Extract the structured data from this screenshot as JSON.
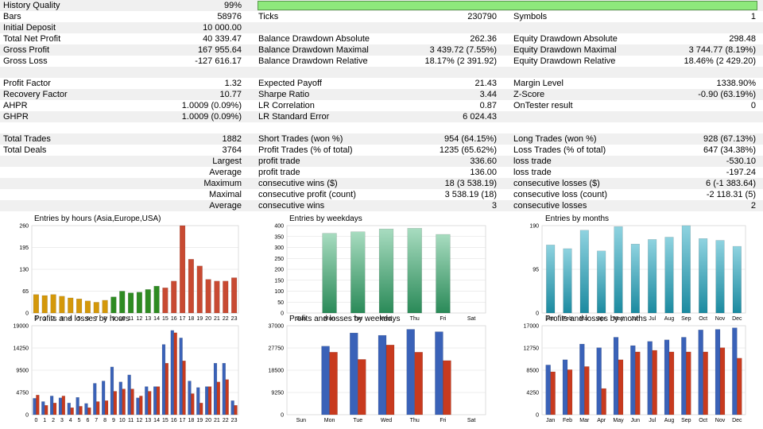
{
  "stats": {
    "rows": [
      {
        "alt": true,
        "cells": [
          {
            "t": "History Quality"
          },
          {
            "t": "99%"
          },
          {
            "t": ""
          },
          {
            "t": ""
          },
          {
            "t": ""
          },
          {
            "t": ""
          }
        ],
        "quality_bar": 0.99
      },
      {
        "alt": false,
        "cells": [
          {
            "t": "Bars"
          },
          {
            "t": "58976"
          },
          {
            "t": "Ticks"
          },
          {
            "t": "230790"
          },
          {
            "t": "Symbols"
          },
          {
            "t": "1"
          }
        ]
      },
      {
        "alt": true,
        "cells": [
          {
            "t": "Initial Deposit"
          },
          {
            "t": "10 000.00"
          },
          {
            "t": ""
          },
          {
            "t": ""
          },
          {
            "t": ""
          },
          {
            "t": ""
          }
        ]
      },
      {
        "alt": false,
        "cells": [
          {
            "t": "Total Net Profit"
          },
          {
            "t": "40 339.47"
          },
          {
            "t": "Balance Drawdown Absolute"
          },
          {
            "t": "262.36"
          },
          {
            "t": "Equity Drawdown Absolute"
          },
          {
            "t": "298.48"
          }
        ]
      },
      {
        "alt": true,
        "cells": [
          {
            "t": "Gross Profit"
          },
          {
            "t": "167 955.64"
          },
          {
            "t": "Balance Drawdown Maximal"
          },
          {
            "t": "3 439.72 (7.55%)"
          },
          {
            "t": "Equity Drawdown Maximal"
          },
          {
            "t": "3 744.77 (8.19%)"
          }
        ]
      },
      {
        "alt": false,
        "cells": [
          {
            "t": "Gross Loss"
          },
          {
            "t": "-127 616.17"
          },
          {
            "t": "Balance Drawdown Relative"
          },
          {
            "t": "18.17% (2 391.92)"
          },
          {
            "t": "Equity Drawdown Relative"
          },
          {
            "t": "18.46% (2 429.20)"
          }
        ]
      },
      {
        "alt": true,
        "cells": [
          {
            "t": ""
          },
          {
            "t": ""
          },
          {
            "t": ""
          },
          {
            "t": ""
          },
          {
            "t": ""
          },
          {
            "t": ""
          }
        ]
      },
      {
        "alt": false,
        "cells": [
          {
            "t": "Profit Factor"
          },
          {
            "t": "1.32"
          },
          {
            "t": "Expected Payoff"
          },
          {
            "t": "21.43"
          },
          {
            "t": "Margin Level"
          },
          {
            "t": "1338.90%"
          }
        ]
      },
      {
        "alt": true,
        "cells": [
          {
            "t": "Recovery Factor"
          },
          {
            "t": "10.77"
          },
          {
            "t": "Sharpe Ratio"
          },
          {
            "t": "3.44"
          },
          {
            "t": "Z-Score"
          },
          {
            "t": "-0.90 (63.19%)"
          }
        ]
      },
      {
        "alt": false,
        "cells": [
          {
            "t": "AHPR"
          },
          {
            "t": "1.0009 (0.09%)"
          },
          {
            "t": "LR Correlation"
          },
          {
            "t": "0.87"
          },
          {
            "t": "OnTester result"
          },
          {
            "t": "0"
          }
        ]
      },
      {
        "alt": true,
        "cells": [
          {
            "t": "GHPR"
          },
          {
            "t": "1.0009 (0.09%)"
          },
          {
            "t": "LR Standard Error"
          },
          {
            "t": "6 024.43"
          },
          {
            "t": ""
          },
          {
            "t": ""
          }
        ]
      },
      {
        "alt": false,
        "cells": [
          {
            "t": ""
          },
          {
            "t": ""
          },
          {
            "t": ""
          },
          {
            "t": ""
          },
          {
            "t": ""
          },
          {
            "t": ""
          }
        ]
      },
      {
        "alt": true,
        "cells": [
          {
            "t": "Total Trades"
          },
          {
            "t": "1882"
          },
          {
            "t": "Short Trades (won %)"
          },
          {
            "t": "954 (64.15%)"
          },
          {
            "t": "Long Trades (won %)"
          },
          {
            "t": "928 (67.13%)"
          }
        ]
      },
      {
        "alt": false,
        "cells": [
          {
            "t": "Total Deals"
          },
          {
            "t": "3764"
          },
          {
            "t": "Profit Trades (% of total)"
          },
          {
            "t": "1235 (65.62%)"
          },
          {
            "t": "Loss Trades (% of total)"
          },
          {
            "t": "647 (34.38%)"
          }
        ]
      },
      {
        "alt": true,
        "cells": [
          {
            "t": ""
          },
          {
            "t": "Largest"
          },
          {
            "t": "profit trade"
          },
          {
            "t": "336.60"
          },
          {
            "t": "loss trade"
          },
          {
            "t": "-530.10"
          }
        ]
      },
      {
        "alt": false,
        "cells": [
          {
            "t": ""
          },
          {
            "t": "Average"
          },
          {
            "t": "profit trade"
          },
          {
            "t": "136.00"
          },
          {
            "t": "loss trade"
          },
          {
            "t": "-197.24"
          }
        ]
      },
      {
        "alt": true,
        "cells": [
          {
            "t": ""
          },
          {
            "t": "Maximum"
          },
          {
            "t": "consecutive wins ($)"
          },
          {
            "t": "18 (3 538.19)"
          },
          {
            "t": "consecutive losses ($)"
          },
          {
            "t": "6 (-1 383.64)"
          }
        ]
      },
      {
        "alt": false,
        "cells": [
          {
            "t": ""
          },
          {
            "t": "Maximal"
          },
          {
            "t": "consecutive profit (count)"
          },
          {
            "t": "3 538.19 (18)"
          },
          {
            "t": "consecutive loss (count)"
          },
          {
            "t": "-2 118.31 (5)"
          }
        ]
      },
      {
        "alt": true,
        "cells": [
          {
            "t": ""
          },
          {
            "t": "Average"
          },
          {
            "t": "consecutive wins"
          },
          {
            "t": "3"
          },
          {
            "t": "consecutive losses"
          },
          {
            "t": "2"
          }
        ]
      },
      {
        "alt": false,
        "cells": [
          {
            "t": ""
          },
          {
            "t": ""
          },
          {
            "t": ""
          },
          {
            "t": ""
          },
          {
            "t": ""
          },
          {
            "t": ""
          }
        ]
      }
    ]
  },
  "colors": {
    "asia": "#d4980a",
    "europe": "#2e8b22",
    "usa": "#c84a32",
    "weekday_top": "#a8dcc0",
    "weekday_bottom": "#2a8a58",
    "month_top": "#8fd3e0",
    "month_bottom": "#1b8aa0",
    "profit": "#3a62b8",
    "loss": "#c83a1e"
  },
  "chart_data": [
    {
      "type": "bar",
      "title": "Entries by hours (Asia,Europe,USA)",
      "categories": [
        "0",
        "1",
        "2",
        "3",
        "4",
        "5",
        "6",
        "7",
        "8",
        "9",
        "10",
        "11",
        "12",
        "13",
        "14",
        "15",
        "16",
        "17",
        "18",
        "19",
        "20",
        "21",
        "22",
        "23"
      ],
      "series": [
        {
          "values": [
            55,
            52,
            55,
            50,
            45,
            42,
            36,
            32,
            38,
            48,
            65,
            60,
            62,
            70,
            80,
            75,
            95,
            260,
            160,
            140,
            100,
            95,
            95,
            105
          ]
        }
      ],
      "bar_colors": [
        "asia",
        "asia",
        "asia",
        "asia",
        "asia",
        "asia",
        "asia",
        "asia",
        "asia",
        "europe",
        "europe",
        "europe",
        "europe",
        "europe",
        "europe",
        "usa",
        "usa",
        "usa",
        "usa",
        "usa",
        "usa",
        "usa",
        "usa",
        "usa"
      ],
      "yticks": [
        "0",
        "65",
        "130",
        "195",
        "260"
      ],
      "ylim": [
        0,
        260
      ]
    },
    {
      "type": "bar",
      "title": "Entries by weekdays",
      "categories": [
        "Sun",
        "Mon",
        "Tue",
        "Wed",
        "Thu",
        "Fri",
        "Sat"
      ],
      "series": [
        {
          "values": [
            0,
            365,
            372,
            385,
            388,
            360,
            0
          ]
        }
      ],
      "yticks": [
        "0",
        "50",
        "100",
        "150",
        "200",
        "250",
        "300",
        "350",
        "400"
      ],
      "ylim": [
        0,
        400
      ]
    },
    {
      "type": "bar",
      "title": "Entries by months",
      "categories": [
        "Jan",
        "Feb",
        "Mar",
        "Apr",
        "May",
        "Jun",
        "Jul",
        "Aug",
        "Sep",
        "Oct",
        "Nov",
        "Dec"
      ],
      "series": [
        {
          "values": [
            148,
            140,
            180,
            135,
            188,
            150,
            160,
            165,
            190,
            162,
            158,
            145
          ]
        }
      ],
      "yticks": [
        "0",
        "95",
        "190"
      ],
      "ylim": [
        0,
        190
      ]
    },
    {
      "type": "bar",
      "title": "Profits and losses by hours",
      "categories": [
        "0",
        "1",
        "2",
        "3",
        "4",
        "5",
        "6",
        "7",
        "8",
        "9",
        "10",
        "11",
        "12",
        "13",
        "14",
        "15",
        "16",
        "17",
        "18",
        "19",
        "20",
        "21",
        "22",
        "23"
      ],
      "series": [
        {
          "name": "profit",
          "values": [
            3500,
            2800,
            4000,
            3600,
            2500,
            3700,
            2400,
            6700,
            7200,
            10200,
            7000,
            8500,
            3600,
            6000,
            6000,
            15000,
            18000,
            16400,
            7200,
            5800,
            6000,
            11000,
            11000,
            3000
          ]
        },
        {
          "name": "loss",
          "values": [
            4200,
            2000,
            2500,
            4000,
            1500,
            1800,
            1500,
            2800,
            3000,
            5000,
            5500,
            5500,
            4000,
            5000,
            6000,
            11000,
            17500,
            11500,
            4500,
            2500,
            6000,
            7000,
            7500,
            2000
          ]
        }
      ],
      "yticks": [
        "0",
        "4750",
        "9500",
        "14250",
        "19000"
      ],
      "ylim": [
        0,
        19000
      ]
    },
    {
      "type": "bar",
      "title": "Profits and losses by weekdays",
      "categories": [
        "Sun",
        "Mon",
        "Tue",
        "Wed",
        "Thu",
        "Fri",
        "Sat"
      ],
      "series": [
        {
          "name": "profit",
          "values": [
            0,
            28500,
            34000,
            33000,
            35500,
            34500,
            0
          ]
        },
        {
          "name": "loss",
          "values": [
            0,
            26000,
            23000,
            29000,
            26000,
            22500,
            0
          ]
        }
      ],
      "yticks": [
        "0",
        "9250",
        "18500",
        "27750",
        "37000"
      ],
      "ylim": [
        0,
        37000
      ]
    },
    {
      "type": "bar",
      "title": "Profits and losses by months",
      "categories": [
        "Jan",
        "Feb",
        "Mar",
        "Apr",
        "May",
        "Jun",
        "Jul",
        "Aug",
        "Sep",
        "Oct",
        "Nov",
        "Dec"
      ],
      "series": [
        {
          "name": "profit",
          "values": [
            9500,
            10500,
            13500,
            12800,
            14800,
            13200,
            14000,
            14300,
            14800,
            16200,
            16300,
            16600
          ]
        },
        {
          "name": "loss",
          "values": [
            8200,
            8600,
            9200,
            5000,
            10500,
            12000,
            12300,
            12000,
            12000,
            12000,
            12800,
            10800
          ]
        }
      ],
      "yticks": [
        "0",
        "4250",
        "8500",
        "12750",
        "17000"
      ],
      "ylim": [
        0,
        17000
      ]
    }
  ]
}
